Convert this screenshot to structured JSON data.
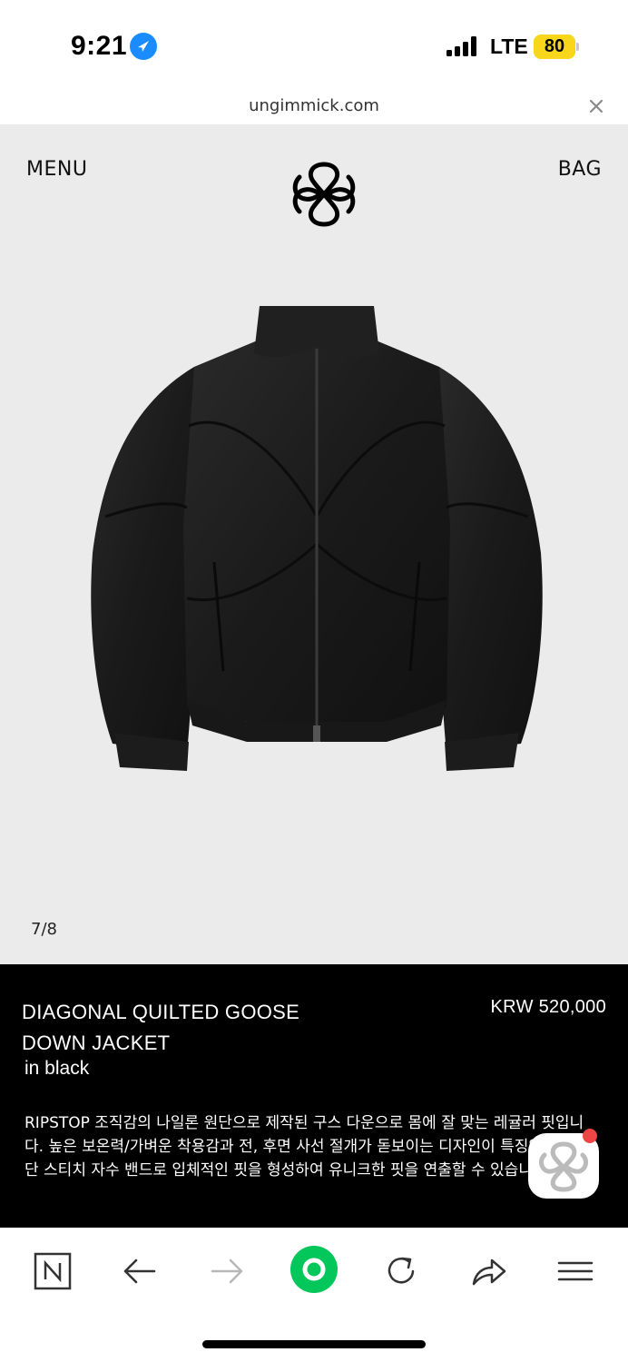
{
  "status_bar": {
    "time": "9:21",
    "network": "LTE",
    "battery": "80",
    "icons": [
      "location-arrow-icon",
      "signal-bars-icon",
      "battery-icon"
    ],
    "battery_color": "#f7d61c"
  },
  "url_bar": {
    "url": "ungimmick.com",
    "close_icon": "close-icon"
  },
  "header": {
    "menu_label": "MENU",
    "bag_label": "BAG",
    "logo_icon": "brand-monogram-logo"
  },
  "gallery": {
    "counter": "7/8",
    "image_icon": "black-puffer-jacket-image"
  },
  "product": {
    "name": "DIAGONAL QUILTED GOOSE DOWN JACKET",
    "color": "in black",
    "price": "KRW 520,000",
    "description": "RIPSTOP 조직감의 나일론 원단으로 제작된 구스 다운으로 몸에 잘 맞는 레귤러 핏입니다. 높은 보온력/가벼운 착용감과 전, 후면 사선 절개가 돋보이는 디자인이 특징입니다. 밑단 스티치 자수 밴드로 입체적인 핏을 형성하여 유니크한 핏을 연출할 수 있습니다."
  },
  "toolbar": {
    "icons": [
      "naver-n-icon",
      "back-arrow-icon",
      "forward-arrow-icon",
      "green-home-icon",
      "reload-icon",
      "share-icon",
      "hamburger-menu-icon"
    ],
    "accent": "#03c75a"
  },
  "colors": {
    "hero_background": "#ebebeb",
    "info_background": "#000000",
    "notification_dot": "#f04545"
  }
}
